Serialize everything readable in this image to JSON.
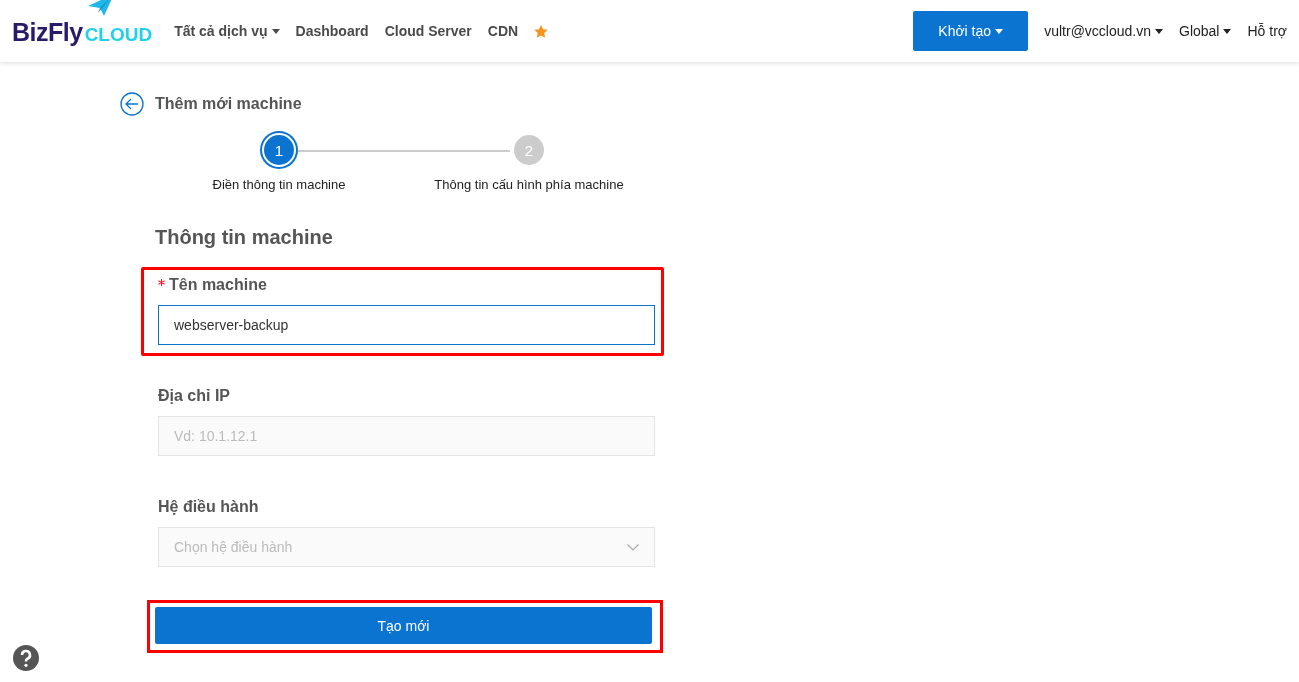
{
  "header": {
    "logo": {
      "brand": "BizFly",
      "suffix": "CLOUD"
    },
    "nav": [
      {
        "label": "Tất cả dịch vụ",
        "dropdown": true
      },
      {
        "label": "Dashboard",
        "dropdown": false
      },
      {
        "label": "Cloud Server",
        "dropdown": false
      },
      {
        "label": "CDN",
        "dropdown": false
      }
    ],
    "create_button": {
      "label": "Khởi tạo",
      "dropdown": true
    },
    "right": [
      {
        "label": "vultr@vccloud.vn",
        "dropdown": true
      },
      {
        "label": "Global",
        "dropdown": true
      },
      {
        "label": "Hỗ trợ",
        "dropdown": false
      }
    ]
  },
  "page_title": "Thêm mới machine",
  "steps": [
    {
      "number": "1",
      "label": "Điền thông tin machine",
      "selected": true
    },
    {
      "number": "2",
      "label": "Thông tin cấu hình phía machine",
      "selected": false
    }
  ],
  "form": {
    "title": "Thông tin machine",
    "fields": [
      {
        "kind": "text",
        "label": "Tên machine",
        "required": true,
        "value": "webserver-backup",
        "focused": true,
        "highlighted": true
      },
      {
        "kind": "text",
        "label": "Địa chỉ IP",
        "required": false,
        "placeholder": "Vd: 10.1.12.1",
        "focused": false,
        "highlighted": false
      },
      {
        "kind": "select",
        "label": "Hệ điều hành",
        "required": false,
        "placeholder": "Chọn hệ điều hành",
        "focused": false,
        "highlighted": false
      }
    ],
    "submit": {
      "label": "Tạo mới",
      "highlighted": true
    }
  }
}
